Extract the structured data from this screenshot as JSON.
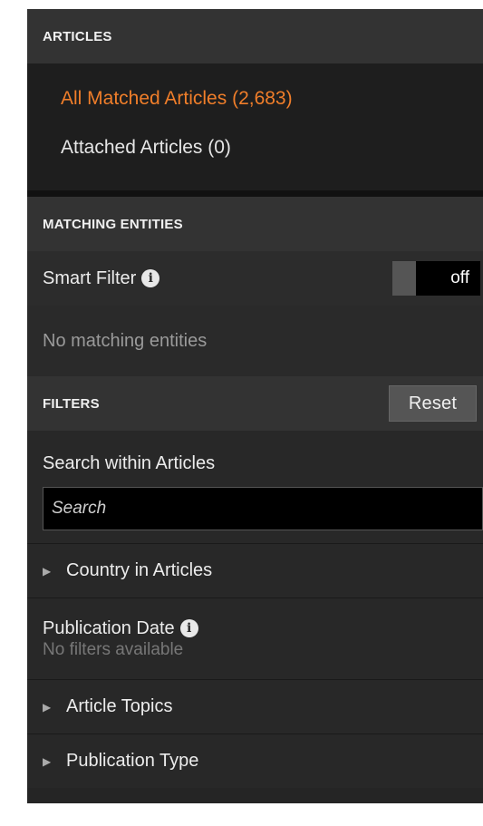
{
  "articles": {
    "header": "ARTICLES",
    "items": [
      {
        "label": "All Matched Articles (2,683)",
        "active": true
      },
      {
        "label": "Attached Articles (0)",
        "active": false
      }
    ]
  },
  "matching_entities": {
    "header": "MATCHING ENTITIES",
    "smart_filter_label": "Smart Filter",
    "toggle_state": "off",
    "empty_text": "No matching entities"
  },
  "filters": {
    "header": "FILTERS",
    "reset_label": "Reset",
    "search_label": "Search within Articles",
    "search_placeholder": "Search",
    "country_label": "Country in Articles",
    "pub_date_label": "Publication Date",
    "pub_date_sub": "No filters available",
    "topics_label": "Article Topics",
    "pub_type_label": "Publication Type"
  },
  "icons": {
    "info": "info-icon",
    "caret": "caret-right-icon"
  },
  "colors": {
    "accent": "#f07e2a",
    "panel_bg": "#252525",
    "header_bg": "#333333"
  }
}
